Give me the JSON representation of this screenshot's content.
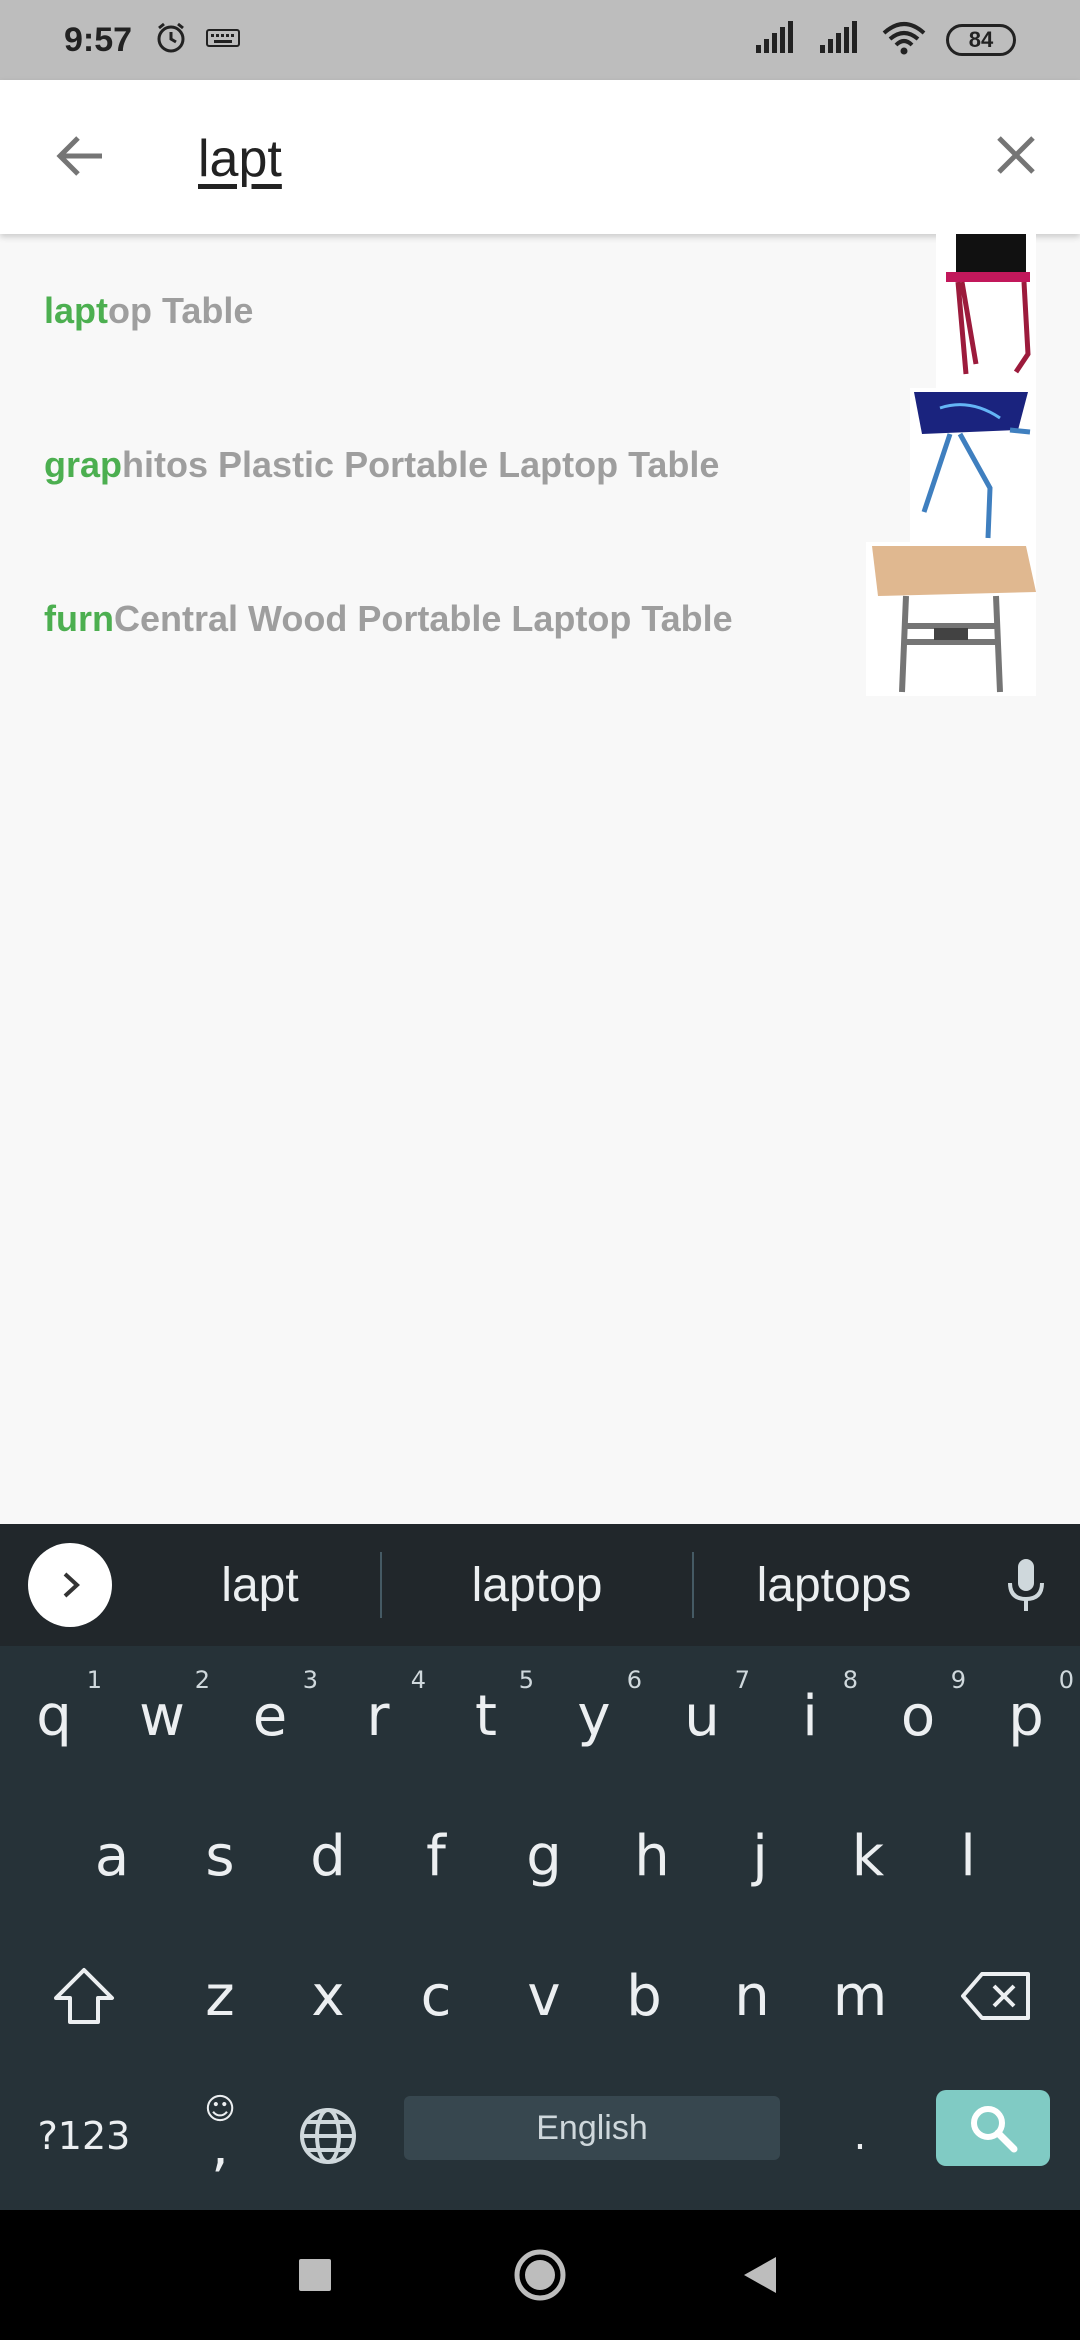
{
  "status_bar": {
    "time": "9:57",
    "battery": "84",
    "icons": [
      "alarm-icon",
      "keyboard-icon",
      "signal-icon",
      "signal-icon",
      "wifi-icon",
      "battery-icon"
    ]
  },
  "search": {
    "query": "lapt",
    "back_icon": "arrow-left-icon",
    "clear_icon": "close-icon"
  },
  "suggestions": [
    {
      "highlight": "lapt",
      "rest": "op Table",
      "thumbnail": "red-laptop-table"
    },
    {
      "highlight": "grap",
      "rest": "hitos Plastic Portable Laptop Table",
      "thumbnail": "blue-plastic-laptop-table"
    },
    {
      "highlight": "furn",
      "rest": "Central Wood Portable Laptop Table",
      "thumbnail": "wood-laptop-table"
    }
  ],
  "keyboard": {
    "suggestions": [
      "lapt",
      "laptop",
      "laptops"
    ],
    "row1": [
      {
        "k": "q",
        "n": "1"
      },
      {
        "k": "w",
        "n": "2"
      },
      {
        "k": "e",
        "n": "3"
      },
      {
        "k": "r",
        "n": "4"
      },
      {
        "k": "t",
        "n": "5"
      },
      {
        "k": "y",
        "n": "6"
      },
      {
        "k": "u",
        "n": "7"
      },
      {
        "k": "i",
        "n": "8"
      },
      {
        "k": "o",
        "n": "9"
      },
      {
        "k": "p",
        "n": "0"
      }
    ],
    "row2": [
      "a",
      "s",
      "d",
      "f",
      "g",
      "h",
      "j",
      "k",
      "l"
    ],
    "row3": [
      "z",
      "x",
      "c",
      "v",
      "b",
      "n",
      "m"
    ],
    "symbols_label": "?123",
    "comma_label": ",",
    "space_label": "English",
    "period_label": ".",
    "accent_color": "#80cbc4"
  },
  "colors": {
    "highlight": "#4caf50",
    "suggestion_text": "#9e9e9e",
    "keyboard_bg": "#263238",
    "status_bar_bg": "#bdbdbd"
  }
}
